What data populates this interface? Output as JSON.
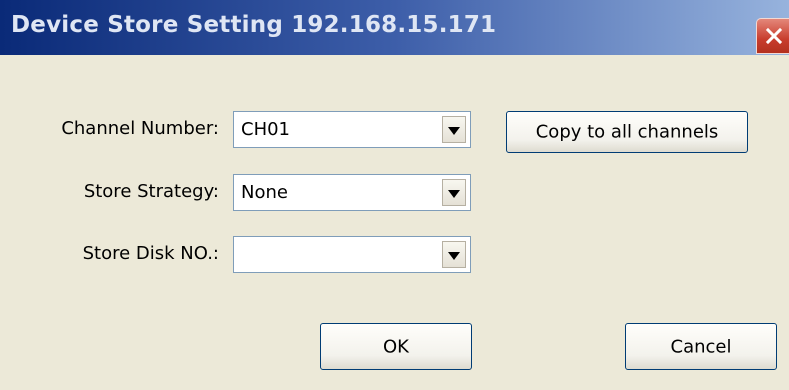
{
  "window": {
    "title": "Device Store Setting 192.168.15.171",
    "close_icon": "close-x-icon"
  },
  "form": {
    "channel_number": {
      "label": "Channel Number:",
      "value": "CH01"
    },
    "store_strategy": {
      "label": "Store Strategy:",
      "value": "None"
    },
    "store_disk_no": {
      "label": "Store Disk NO.:",
      "value": ""
    }
  },
  "buttons": {
    "copy_to_all_channels": "Copy to all channels",
    "ok": "OK",
    "cancel": "Cancel"
  },
  "colors": {
    "dialog_background": "#ece9d8",
    "titlebar_start": "#0a2a78",
    "titlebar_end": "#97b3dd",
    "close_button": "#c83d2d"
  }
}
